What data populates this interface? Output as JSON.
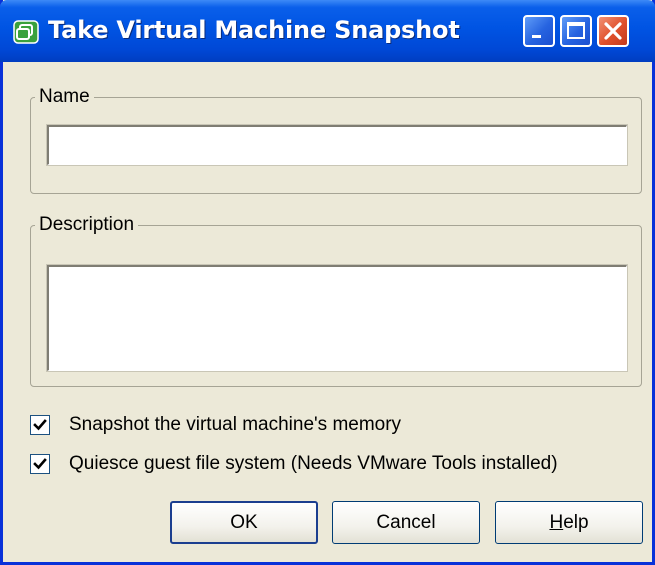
{
  "window": {
    "title": "Take Virtual Machine Snapshot",
    "icon": "vsphere-icon",
    "controls": {
      "minimize": "minimize-icon",
      "maximize": "maximize-icon",
      "close": "close-icon"
    }
  },
  "name_group": {
    "legend": "Name",
    "value": ""
  },
  "description_group": {
    "legend": "Description",
    "value": ""
  },
  "options": [
    {
      "label": "Snapshot the virtual machine's memory",
      "checked": true
    },
    {
      "label": "Quiesce guest file system (Needs VMware Tools installed)",
      "checked": true
    }
  ],
  "buttons": {
    "ok": "OK",
    "cancel": "Cancel",
    "help_accel": "H",
    "help_rest": "elp"
  },
  "colors": {
    "titlebar": "#0054e3",
    "close_button": "#e0502b",
    "dialog_face": "#ece9d8",
    "icon_green": "#3aa13c"
  }
}
